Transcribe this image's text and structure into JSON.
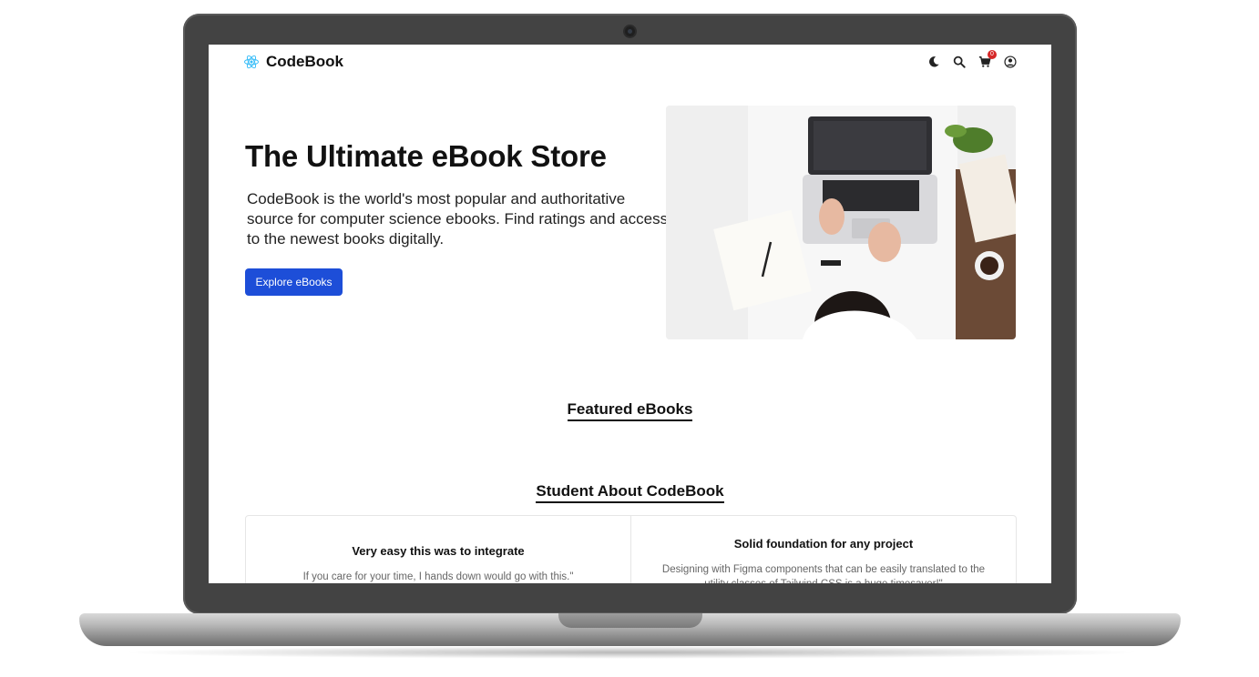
{
  "app": {
    "brand": "CodeBook"
  },
  "header": {
    "icons": [
      "moon-icon",
      "search-icon",
      "cart-icon",
      "user-icon"
    ],
    "cart_count": "0"
  },
  "hero": {
    "title": "The Ultimate eBook Store",
    "description": "CodeBook is the world's most popular and authoritative source for computer science ebooks. Find ratings and access to the newest books digitally.",
    "button_label": "Explore eBooks"
  },
  "sections": {
    "featured_title": "Featured eBooks",
    "testimonials_title": "Student About CodeBook"
  },
  "testimonials": [
    {
      "title": "Very easy this was to integrate",
      "body": "If you care for your time, I hands down would go with this.\""
    },
    {
      "title": "Solid foundation for any project",
      "body": "Designing with Figma components that can be easily translated to the utility classes of Tailwind CSS is a huge timesaver!\""
    }
  ],
  "colors": {
    "accent": "#1d4ed8",
    "badge": "#d62828",
    "text": "#111111"
  }
}
